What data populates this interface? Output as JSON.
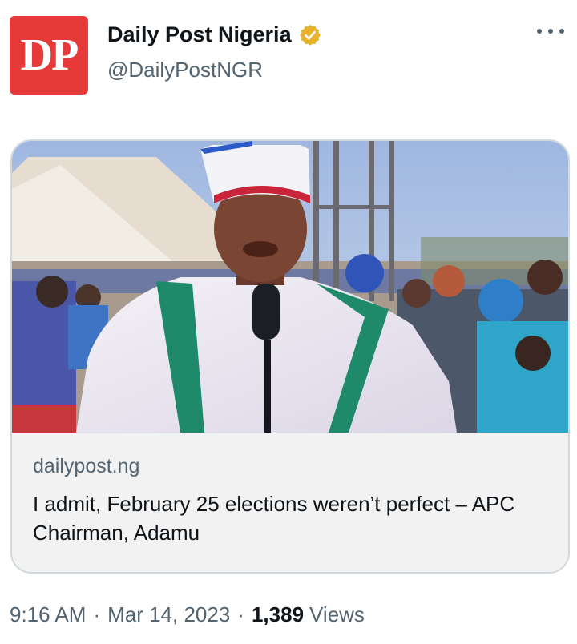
{
  "colors": {
    "avatar_bg": "#e63a3a",
    "verified_badge": "#e8b32a",
    "secondary_text": "#536471",
    "card_border": "#cfd9de"
  },
  "author": {
    "avatar_text": "DP",
    "name": "Daily Post Nigeria",
    "handle": "@DailyPostNGR",
    "verified_icon": "verified-badge-gold"
  },
  "more_icon": "more-horizontal-icon",
  "link_card": {
    "image_alt": "photo-man-speaking-into-microphone",
    "domain": "dailypost.ng",
    "headline": "I admit, February 25 elections weren’t perfect – APC Chairman, Adamu"
  },
  "meta": {
    "time": "9:16 AM",
    "date": "Mar 14, 2023",
    "views_count": "1,389",
    "views_label": "Views"
  }
}
